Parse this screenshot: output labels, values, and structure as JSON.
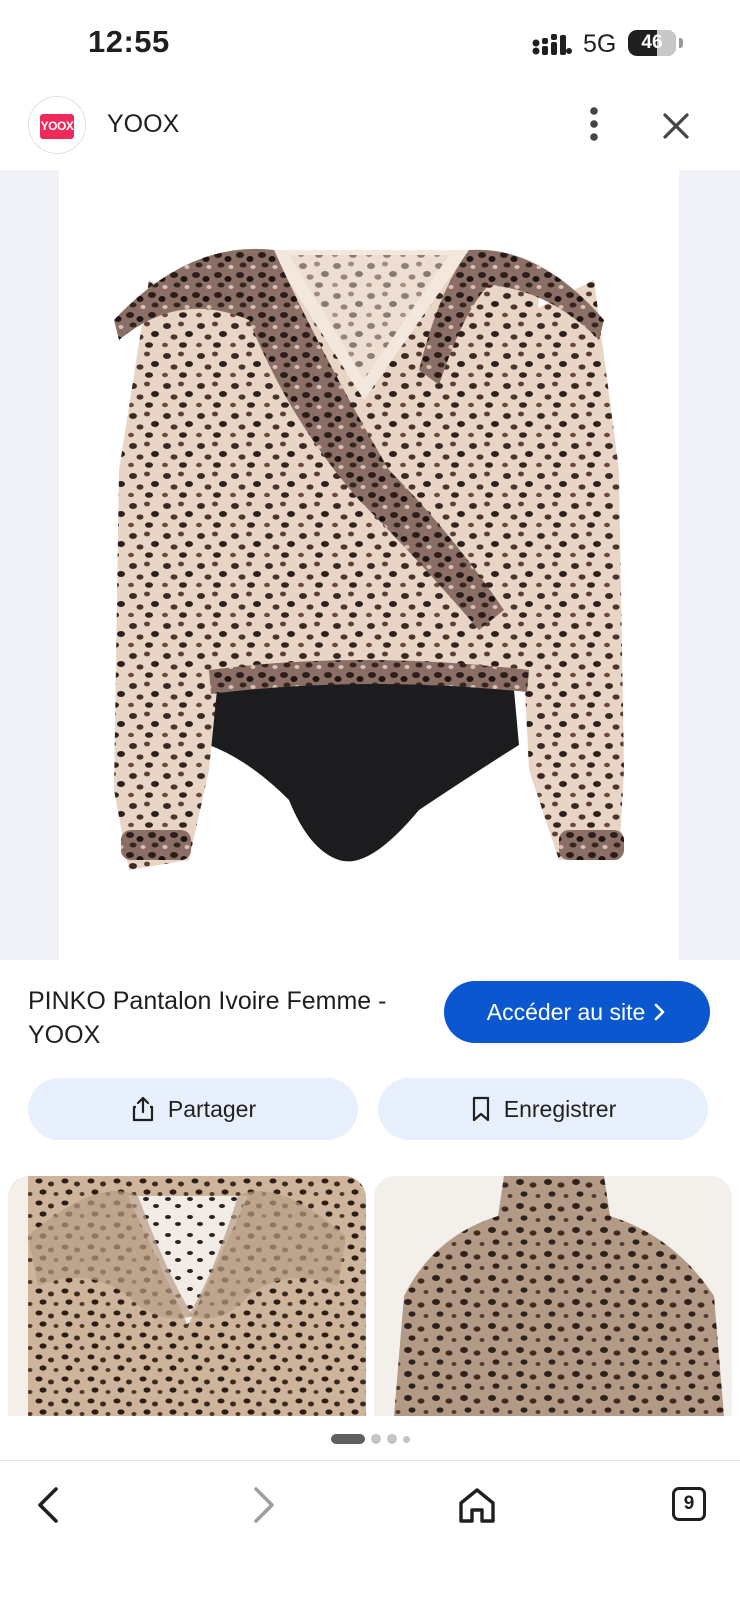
{
  "status_bar": {
    "time": "12:55",
    "network": "5G",
    "battery": "46"
  },
  "header": {
    "site_logo_text": "YOOX",
    "site_name": "YOOX"
  },
  "product": {
    "title": "PINKO Pantalon Ivoire Femme - YOOX",
    "visit_label": "Accéder au site"
  },
  "actions": {
    "share_label": "Partager",
    "save_label": "Enregistrer"
  },
  "carousel": {
    "page_count": 4,
    "active_index": 0
  },
  "nav": {
    "tab_count": "9"
  },
  "colors": {
    "accent": "#0b57d0",
    "button_tint": "#e8effd",
    "logo": "#ee2a5a"
  }
}
